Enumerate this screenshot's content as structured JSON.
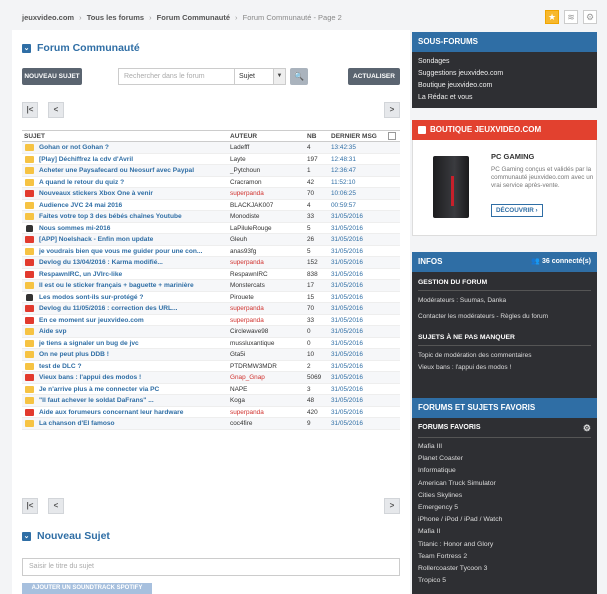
{
  "breadcrumb": {
    "items": [
      "jeuxvideo.com",
      "Tous les forums",
      "Forum Communauté",
      "Forum Communauté - Page 2"
    ]
  },
  "forum": {
    "title": "Forum Communauté",
    "new_topic_btn": "NOUVEAU SUJET",
    "search_placeholder": "Rechercher dans le forum",
    "search_scope": "Sujet",
    "refresh_btn": "ACTUALISER",
    "columns": {
      "subject": "SUJET",
      "author": "AUTEUR",
      "nb": "NB",
      "last": "DERNIER MSG"
    },
    "topics": [
      {
        "icon": "yellow",
        "subject": "Gohan or not Gohan ?",
        "author": "Ladefff",
        "author_color": "normal",
        "nb": "4",
        "last": "13:42:35"
      },
      {
        "icon": "yellow",
        "subject": "[Play] Déchiffrez la cdv d'Avril",
        "author": "Layte",
        "author_color": "normal",
        "nb": "197",
        "last": "12:48:31"
      },
      {
        "icon": "yellow",
        "subject": "Acheter une Paysafecard ou Neosurf avec Paypal",
        "author": "_Pytchoun",
        "author_color": "normal",
        "nb": "1",
        "last": "12:36:47"
      },
      {
        "icon": "yellow",
        "subject": "A quand le retour du quiz ?",
        "author": "Cracramon",
        "author_color": "normal",
        "nb": "42",
        "last": "11:52:10"
      },
      {
        "icon": "red",
        "subject": "Nouveaux stickers Xbox One à venir",
        "author": "superpanda",
        "author_color": "red",
        "nb": "70",
        "last": "10:06:25"
      },
      {
        "icon": "yellow",
        "subject": "Audience JVC 24 mai 2016",
        "author": "BLACKJAK007",
        "author_color": "normal",
        "nb": "4",
        "last": "00:59:57"
      },
      {
        "icon": "yellow",
        "subject": "Faites votre top 3 des bébés chaînes Youtube",
        "author": "Monodiste",
        "author_color": "normal",
        "nb": "33",
        "last": "31/05/2016"
      },
      {
        "icon": "lock",
        "subject": "Nous sommes mi-2016",
        "author": "LaPiluleRouge",
        "author_color": "normal",
        "nb": "5",
        "last": "31/05/2016"
      },
      {
        "icon": "red",
        "subject": "[APP] Noelshack - Enfin mon update",
        "author": "Gleuh",
        "author_color": "normal",
        "nb": "26",
        "last": "31/05/2016"
      },
      {
        "icon": "yellow",
        "subject": "je voudrais bien que vous me guider pour une con...",
        "author": "anas93fg",
        "author_color": "normal",
        "nb": "5",
        "last": "31/05/2016"
      },
      {
        "icon": "red",
        "subject": "Devlog du 13/04/2016 : Karma modifié...",
        "author": "superpanda",
        "author_color": "red",
        "nb": "152",
        "last": "31/05/2016"
      },
      {
        "icon": "red",
        "subject": "RespawnIRC, un JVIrc-like",
        "author": "RespawnIRC",
        "author_color": "normal",
        "nb": "838",
        "last": "31/05/2016"
      },
      {
        "icon": "yellow",
        "subject": "Il est ou le sticker français + baguette + marinière",
        "author": "Monstercats",
        "author_color": "normal",
        "nb": "17",
        "last": "31/05/2016"
      },
      {
        "icon": "lock",
        "subject": "Les modos sont-ils sur-protégé ?",
        "author": "Pirouete",
        "author_color": "normal",
        "nb": "15",
        "last": "31/05/2016"
      },
      {
        "icon": "red",
        "subject": "Devlog du 11/05/2016 : correction des URL...",
        "author": "superpanda",
        "author_color": "red",
        "nb": "70",
        "last": "31/05/2016"
      },
      {
        "icon": "red",
        "subject": "En ce moment sur jeuxvideo.com",
        "author": "superpanda",
        "author_color": "red",
        "nb": "33",
        "last": "31/05/2016"
      },
      {
        "icon": "yellow",
        "subject": "Aide svp",
        "author": "Circlewave98",
        "author_color": "normal",
        "nb": "0",
        "last": "31/05/2016"
      },
      {
        "icon": "yellow",
        "subject": "je tiens a signaler un bug de jvc",
        "author": "mussluxantique",
        "author_color": "normal",
        "nb": "0",
        "last": "31/05/2016"
      },
      {
        "icon": "yellow",
        "subject": "On ne peut plus DDB !",
        "author": "Gta5i",
        "author_color": "normal",
        "nb": "10",
        "last": "31/05/2016"
      },
      {
        "icon": "yellow",
        "subject": "test de DLC ?",
        "author": "PTDRMW3MDR",
        "author_color": "normal",
        "nb": "2",
        "last": "31/05/2016"
      },
      {
        "icon": "red",
        "subject": "Vieux bans : l'appui des modos !",
        "author": "Gnap_Gnap",
        "author_color": "red",
        "nb": "5069",
        "last": "31/05/2016"
      },
      {
        "icon": "yellow",
        "subject": "Je n'arrive plus à me connecter via PC",
        "author": "NAPE",
        "author_color": "normal",
        "nb": "3",
        "last": "31/05/2016"
      },
      {
        "icon": "yellow",
        "subject": "\"Il faut achever le soldat DaFrans\" ...",
        "author": "Koga",
        "author_color": "normal",
        "nb": "48",
        "last": "31/05/2016"
      },
      {
        "icon": "red",
        "subject": "Aide aux forumeurs concernant leur hardware",
        "author": "superpanda",
        "author_color": "red",
        "nb": "420",
        "last": "31/05/2016"
      },
      {
        "icon": "yellow",
        "subject": "La chanson d'El famoso",
        "author": "coc4fire",
        "author_color": "normal",
        "nb": "9",
        "last": "31/05/2016"
      }
    ]
  },
  "new_topic": {
    "title": "Nouveau Sujet",
    "title_placeholder": "Saisir le titre du sujet",
    "soundtrack_btn": "AJOUTER UN SOUNDTRACK SPOTIFY"
  },
  "sidebar": {
    "sous_forums": {
      "title": "SOUS-FORUMS",
      "links": [
        "Sondages",
        "Suggestions jeuxvideo.com",
        "Boutique jeuxvideo.com",
        "La Rédac et vous"
      ]
    },
    "boutique": {
      "title": "BOUTIQUE JEUXVIDEO.COM",
      "product_title": "PC GAMING",
      "product_desc": "PC Gaming conçus et validés par la communauté jeuxvideo.com avec un vrai service après-vente.",
      "cta": "DÉCOUVRIR"
    },
    "infos": {
      "title": "INFOS",
      "connected": "36 connecté(s)",
      "gestion_title": "GESTION DU FORUM",
      "moderators": "Modérateurs : Suumas, Danka",
      "contact": "Contacter les modérateurs - Règles du forum",
      "must_see_title": "SUJETS À NE PAS MANQUER",
      "must_see": [
        "Topic de modération des commentaires",
        "Vieux bans : l'appui des modos !"
      ]
    },
    "favs": {
      "title": "FORUMS ET SUJETS FAVORIS",
      "sub_title": "FORUMS FAVORIS",
      "items": [
        "Mafia III",
        "Planet Coaster",
        "Informatique",
        "American Truck Simulator",
        "Cities Skylines",
        "Emergency 5",
        "iPhone / iPod / iPad / Watch",
        "Mafia II",
        "Titanic : Honor and Glory",
        "Team Fortress 2",
        "Rollercoaster Tycoon 3",
        "Tropico 5"
      ]
    }
  },
  "colors": {
    "accent_blue": "#2f6ea5",
    "accent_red": "#e2412f",
    "dark_panel": "#2e2f33"
  }
}
